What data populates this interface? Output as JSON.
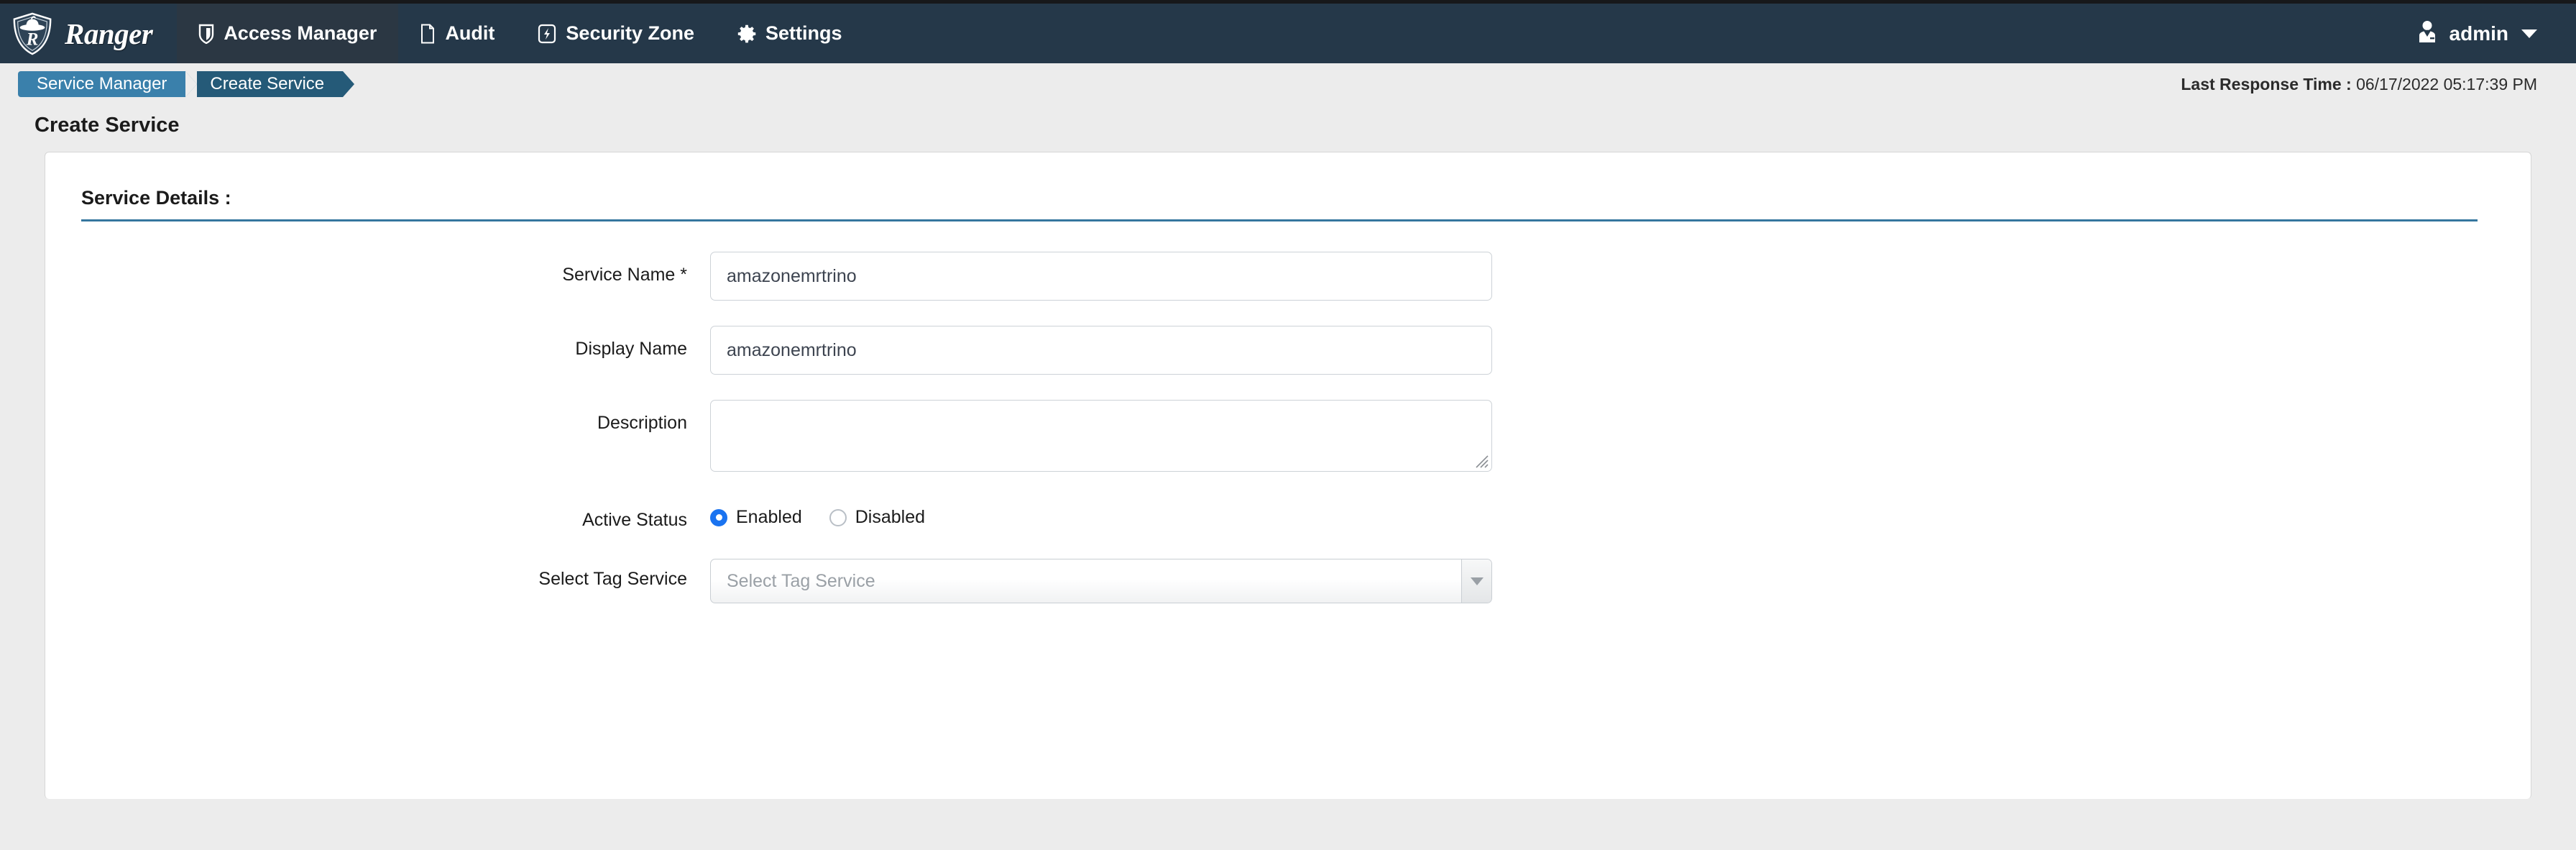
{
  "brand": {
    "name": "Ranger",
    "logo_icon": "ranger-shield-logo"
  },
  "navbar": {
    "items": [
      {
        "label": "Access Manager",
        "icon": "shield-icon",
        "active": true
      },
      {
        "label": "Audit",
        "icon": "file-icon",
        "active": false
      },
      {
        "label": "Security Zone",
        "icon": "bolt-in-square-icon",
        "active": false
      },
      {
        "label": "Settings",
        "icon": "gear-icon",
        "active": false
      }
    ],
    "user": {
      "name": "admin",
      "icon": "user-tie-icon",
      "caret_icon": "caret-down-icon"
    }
  },
  "breadcrumb": {
    "items": [
      {
        "label": "Service Manager"
      },
      {
        "label": "Create Service"
      }
    ]
  },
  "status": {
    "last_response_label": "Last Response Time :",
    "last_response_value": "06/17/2022 05:17:39 PM"
  },
  "page": {
    "title": "Create Service"
  },
  "section": {
    "title": "Service Details :"
  },
  "form": {
    "service_name": {
      "label": "Service Name *",
      "value": "amazonemrtrino",
      "placeholder": ""
    },
    "display_name": {
      "label": "Display Name",
      "value": "amazonemrtrino",
      "placeholder": ""
    },
    "description": {
      "label": "Description",
      "value": "",
      "placeholder": ""
    },
    "active_status": {
      "label": "Active Status",
      "options": [
        {
          "label": "Enabled",
          "selected": true
        },
        {
          "label": "Disabled",
          "selected": false
        }
      ]
    },
    "tag_service": {
      "label": "Select Tag Service",
      "placeholder": "Select Tag Service",
      "value": ""
    }
  },
  "colors": {
    "navbar_bg": "#253849",
    "navbar_active": "#2b3743",
    "crumb_first": "#3a80ab",
    "crumb_second": "#255a78",
    "section_rule": "#35769e",
    "radio_accent": "#1a73f0",
    "page_bg": "#ececec"
  }
}
